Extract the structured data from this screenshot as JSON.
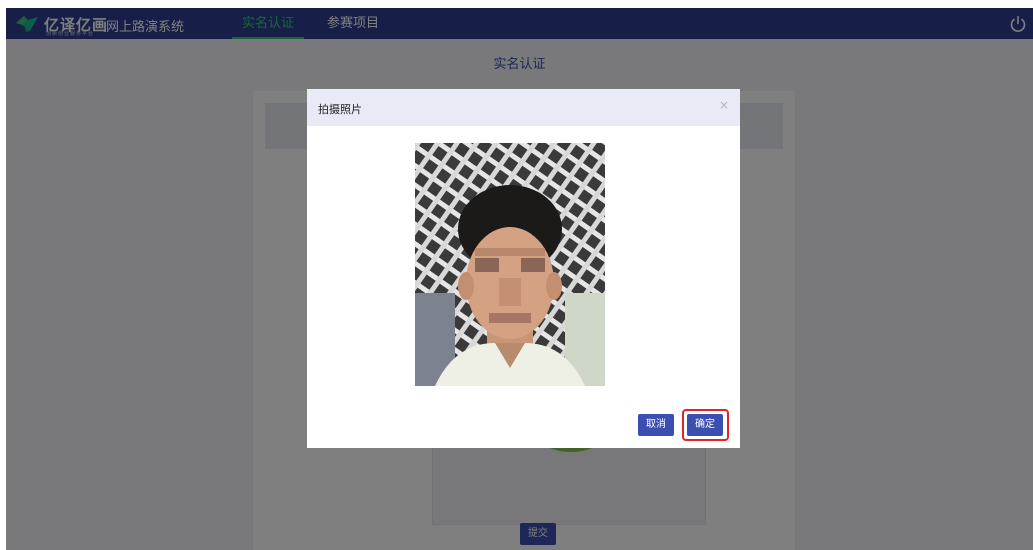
{
  "header": {
    "brand": "亿译亿画",
    "brand_sub": "创新创业服务平台",
    "app_title": "网上路演系统",
    "tabs": [
      {
        "label": "实名认证",
        "active": true
      },
      {
        "label": "参赛项目",
        "active": false
      }
    ],
    "power_icon": "power-icon"
  },
  "page": {
    "title": "实名认证",
    "submit_label": "提交"
  },
  "modal": {
    "title": "拍摄照片",
    "close_glyph": "×",
    "cancel_label": "取消",
    "ok_label": "确定"
  },
  "colors": {
    "brand": "#2f3f93",
    "accent": "#3b4fb0",
    "active_tab": "#2ecc71",
    "highlight": "#e3242b"
  }
}
